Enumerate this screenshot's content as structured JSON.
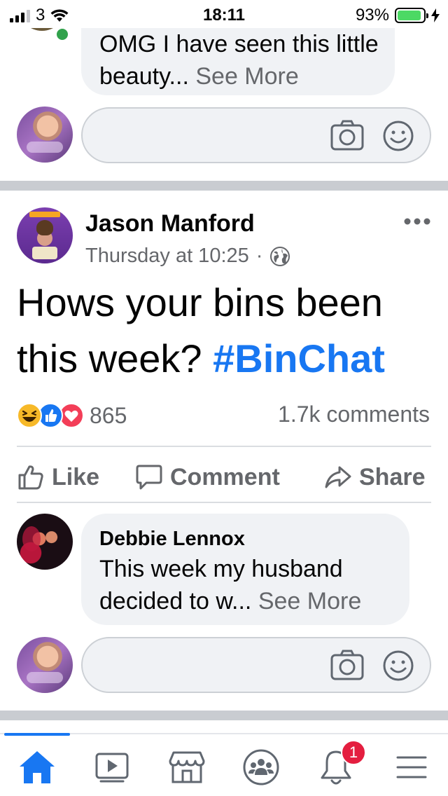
{
  "status_bar": {
    "carrier_signal": "3",
    "time": "18:11",
    "battery_percent": "93%",
    "battery_level": 0.93
  },
  "previous_comment": {
    "text": "OMG I have seen this little beauty...",
    "see_more": "See More"
  },
  "post": {
    "author": "Jason Manford",
    "timestamp": "Thursday at 10:25",
    "separator": "·",
    "audience_icon": "globe-icon",
    "text": "Hows your bins been this week?",
    "hashtag": "#BinChat",
    "reactions": [
      "haha",
      "like",
      "love"
    ],
    "reaction_count": "865",
    "comment_count": "1.7k comments",
    "more_icon": "more-horizontal-icon"
  },
  "actions": {
    "like": "Like",
    "comment": "Comment",
    "share": "Share"
  },
  "top_comment": {
    "author": "Debbie Lennox",
    "text": "This week my husband decided to w...",
    "see_more": "See More"
  },
  "composer": {
    "camera_icon": "camera-icon",
    "emoji_icon": "emoji-icon"
  },
  "tabbar": {
    "tabs": [
      "home-icon",
      "video-icon",
      "marketplace-icon",
      "groups-icon",
      "notifications-icon",
      "menu-icon"
    ],
    "notifications_badge": "1",
    "accent": "#1877f2"
  }
}
